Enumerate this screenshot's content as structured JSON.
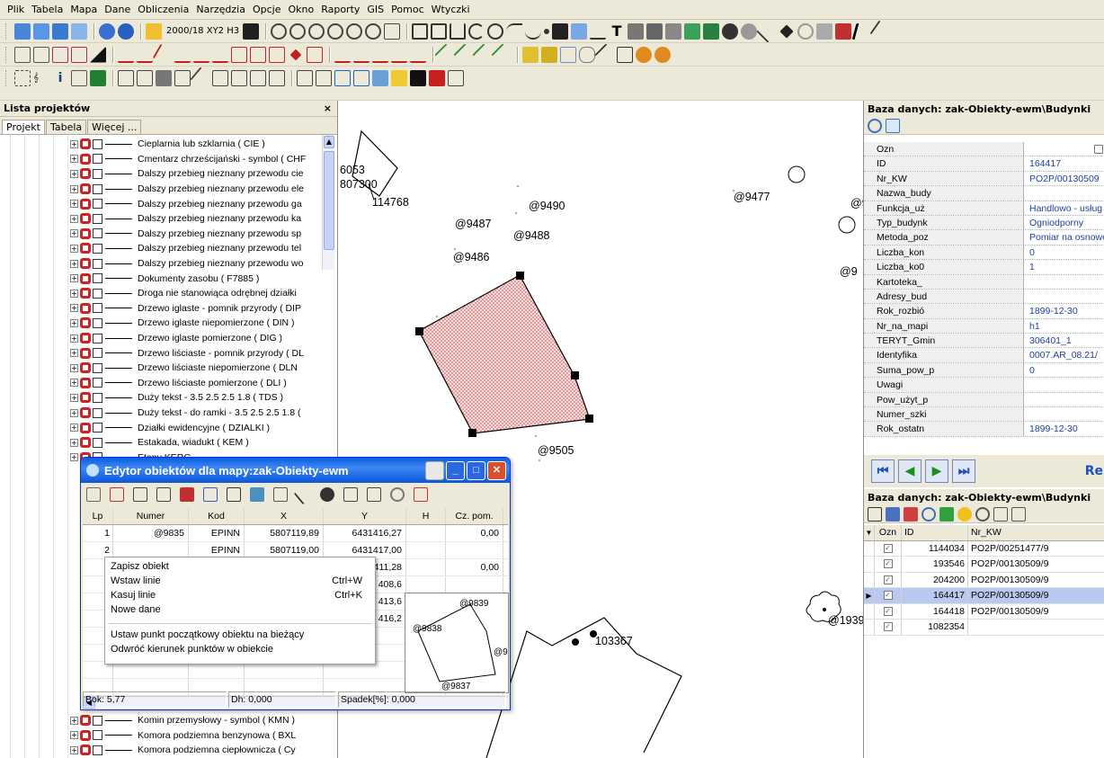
{
  "menu": [
    "Plik",
    "Tabela",
    "Mapa",
    "Dane",
    "Obliczenia",
    "Narzędzia",
    "Opcje",
    "Okno",
    "Raporty",
    "GIS",
    "Pomoc",
    "Wtyczki"
  ],
  "toolbar": {
    "coord_system": "2000/18 XY2 H3"
  },
  "left_panel": {
    "title": "Lista projektów",
    "close": "×",
    "tabs": [
      "Projekt",
      "Tabela",
      "Więcej ..."
    ],
    "items_top": [
      "Cieplarnia lub szklarnia ( CIE )",
      "Cmentarz chrześcijański - symbol ( CHF",
      "Dalszy przebieg nieznany przewodu cie",
      "Dalszy przebieg nieznany przewodu ele",
      "Dalszy przebieg nieznany przewodu ga",
      "Dalszy przebieg nieznany przewodu ka",
      "Dalszy przebieg nieznany przewodu sp",
      "Dalszy przebieg nieznany przewodu tel",
      "Dalszy przebieg nieznany przewodu wo",
      "Dokumenty zasobu ( F7885 )",
      "Droga nie stanowiąca odrębnej działki",
      "Drzewo iglaste - pomnik przyrody ( DIP",
      "Drzewo iglaste niepomierzone ( DIN )",
      "Drzewo iglaste pomierzone ( DIG )",
      "Drzewo liściaste - pomnik przyrody ( DL",
      "Drzewo liściaste niepomierzone ( DLN",
      "Drzewo liściaste pomierzone ( DLI )",
      "Duży tekst - 3.5 2.5 2.5 1.8 ( TDS )",
      "Duży tekst - do ramki - 3.5 2.5 2.5 1.8 (",
      "Działki ewidencyjne ( DZIALKI )",
      "Estakada, wiadukt ( KEM )",
      "Etapy KERG"
    ],
    "items_bottom": [
      "Komin przemysłowy - symbol ( KMN )",
      "Komora podziemna benzynowa ( BXL",
      "Komora podziemna ciepłownicza ( Cy"
    ]
  },
  "map": {
    "labels": [
      "@9477",
      "@9490",
      "@9487",
      "@9488",
      "@9486",
      "@9505",
      "@9",
      "@9",
      "103367",
      "@1939",
      "114768",
      "6053",
      "807300"
    ]
  },
  "right_panel": {
    "title": "Baza danych: zak-Obiekty-ewm\\Budynki",
    "props": [
      {
        "key": "Ozn",
        "value": ""
      },
      {
        "key": "ID",
        "value": "164417"
      },
      {
        "key": "Nr_KW",
        "value": "PO2P/00130509"
      },
      {
        "key": "Nazwa_budy",
        "value": ""
      },
      {
        "key": "Funkcja_uż",
        "value": "Handlowo - usług"
      },
      {
        "key": "Typ_budynk",
        "value": "Ogniodporny"
      },
      {
        "key": "Metoda_poz",
        "value": "Pomiar na osnowę"
      },
      {
        "key": "Liczba_kon",
        "value": "0"
      },
      {
        "key": "Liczba_ko0",
        "value": "1"
      },
      {
        "key": "Kartoteka_",
        "value": ""
      },
      {
        "key": "Adresy_bud",
        "value": ""
      },
      {
        "key": "Rok_rozbió",
        "value": "1899-12-30"
      },
      {
        "key": "Nr_na_mapi",
        "value": "h1"
      },
      {
        "key": "TERYT_Gmin",
        "value": "306401_1"
      },
      {
        "key": "Identyfika",
        "value": "0007.AR_08.21/"
      },
      {
        "key": "Suma_pow_p",
        "value": "0"
      },
      {
        "key": "Uwagi",
        "value": ""
      },
      {
        "key": "Pow_użyt_p",
        "value": ""
      },
      {
        "key": "Numer_szki",
        "value": ""
      },
      {
        "key": "Rok_ostatn",
        "value": "1899-12-30"
      }
    ],
    "nav_extra": "Re",
    "title2": "Baza danych: zak-Obiekty-ewm\\Budynki",
    "grid_headers": [
      "Ozn",
      "ID",
      "Nr_KW"
    ],
    "grid_rows": [
      {
        "id": "1144034",
        "nr_kw": "PO2P/00251477/9",
        "selected": false
      },
      {
        "id": "193546",
        "nr_kw": "PO2P/00130509/9",
        "selected": false
      },
      {
        "id": "204200",
        "nr_kw": "PO2P/00130509/9",
        "selected": false
      },
      {
        "id": "164417",
        "nr_kw": "PO2P/00130509/9",
        "selected": true
      },
      {
        "id": "164418",
        "nr_kw": "PO2P/00130509/9",
        "selected": false
      },
      {
        "id": "1082354",
        "nr_kw": "",
        "selected": false
      }
    ]
  },
  "editor": {
    "title": "Edytor obiektów dla mapy:zak-Obiekty-ewm",
    "headers": [
      "Lp",
      "Numer",
      "Kod",
      "X",
      "Y",
      "H",
      "Cz. pom."
    ],
    "rows": [
      {
        "lp": "1",
        "numer": "@9835",
        "kod": "EPINN",
        "x": "5807119,89",
        "y": "6431416,27",
        "h": "",
        "cz": "0,00"
      },
      {
        "lp": "2",
        "numer": "",
        "kod": "EPINN",
        "x": "5807119,00",
        "y": "6431417,00",
        "h": "",
        "cz": ""
      },
      {
        "lp": "",
        "numer": "",
        "kod": "",
        "x": "",
        "y": "411,28",
        "h": "",
        "cz": "0,00"
      },
      {
        "lp": "",
        "numer": "",
        "kod": "",
        "x": "",
        "y": "408,6",
        "h": "",
        "cz": ""
      },
      {
        "lp": "",
        "numer": "",
        "kod": "",
        "x": "",
        "y": "413,6",
        "h": "",
        "cz": ""
      },
      {
        "lp": "",
        "numer": "",
        "kod": "",
        "x": "",
        "y": "416,2",
        "h": "",
        "cz": ""
      }
    ],
    "status": {
      "bok": "Bok: 5,77",
      "dh": "Dh: 0,000",
      "spadek": "Spadek[%]: 0,000"
    },
    "preview_labels": [
      "@9839",
      "@9838",
      "@9837",
      "@9"
    ]
  },
  "context_menu": [
    {
      "label": "Zapisz obiekt",
      "shortcut": ""
    },
    {
      "label": "Wstaw linie",
      "shortcut": "Ctrl+W"
    },
    {
      "label": "Kasuj linie",
      "shortcut": "Ctrl+K"
    },
    {
      "label": "Nowe dane",
      "shortcut": ""
    },
    {
      "label": "Ustaw punkt początkowy obiektu na bieżący",
      "shortcut": ""
    },
    {
      "label": "Odwróć kierunek punktów w obiekcie",
      "shortcut": ""
    }
  ]
}
